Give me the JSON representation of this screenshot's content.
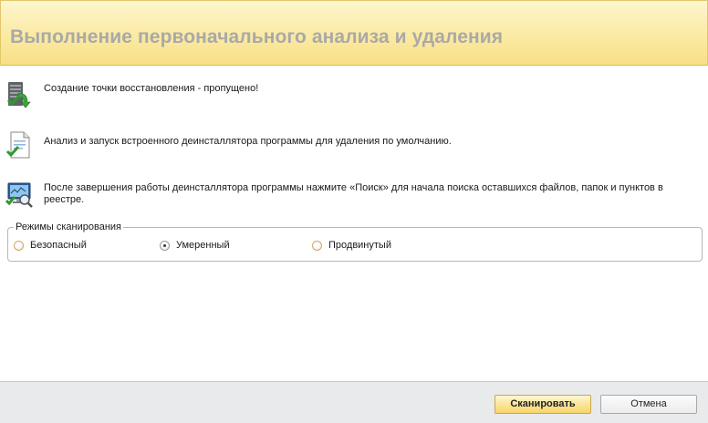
{
  "header": {
    "title": "Выполнение первоначального анализа и удаления"
  },
  "steps": [
    {
      "icon": "restore-point-server-icon",
      "text": "Создание точки восстановления - пропущено!"
    },
    {
      "icon": "document-check-icon",
      "text": "Анализ и запуск встроенного деинсталлятора программы для удаления по умолчанию."
    },
    {
      "icon": "monitor-search-icon",
      "text": "После завершения работы деинсталлятора программы нажмите «Поиск» для начала поиска оставшихся файлов, папок и пунктов в реестре."
    }
  ],
  "scan_modes": {
    "legend": "Режимы сканирования",
    "options": [
      {
        "label": "Безопасный",
        "selected": false
      },
      {
        "label": "Умеренный",
        "selected": true
      },
      {
        "label": "Продвинутый",
        "selected": false
      }
    ]
  },
  "buttons": {
    "scan": "Сканировать",
    "cancel": "Отмена"
  }
}
